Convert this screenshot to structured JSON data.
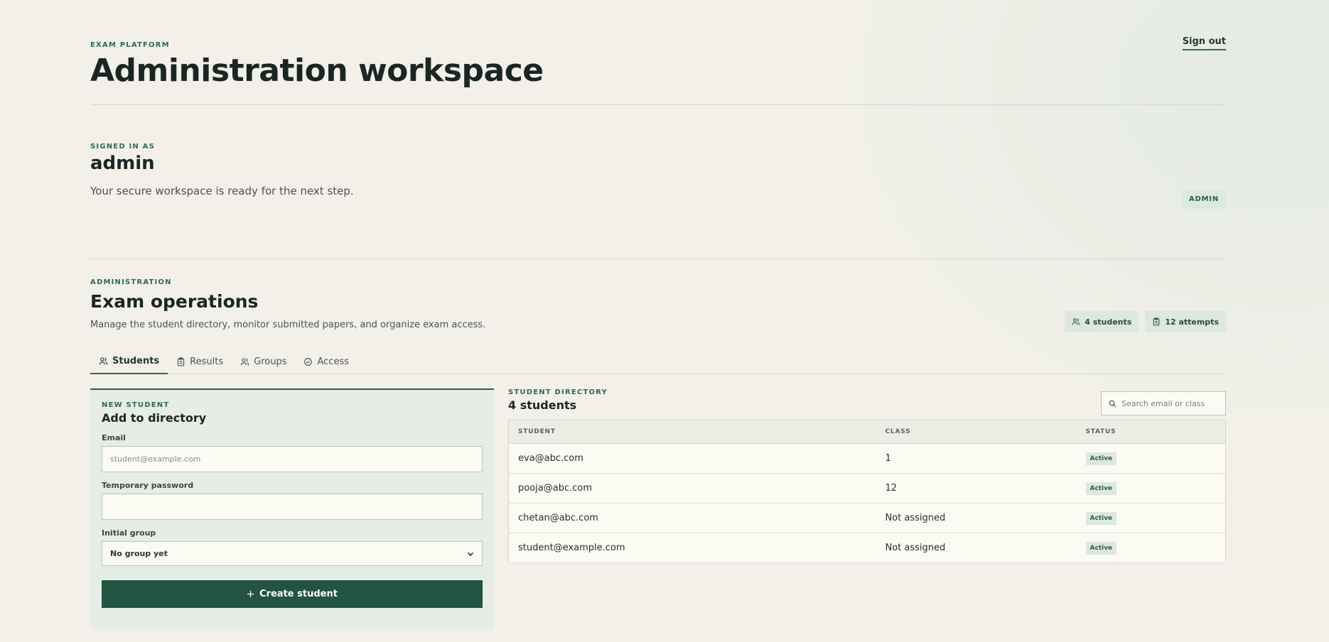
{
  "header": {
    "eyebrow": "EXAM PLATFORM",
    "title": "Administration workspace",
    "signout_label": "Sign out"
  },
  "session": {
    "eyebrow": "SIGNED IN AS",
    "username": "admin",
    "message": "Your secure workspace is ready for the next step.",
    "role_badge": "ADMIN"
  },
  "admin": {
    "eyebrow": "ADMINISTRATION",
    "title": "Exam operations",
    "description": "Manage the student directory, monitor submitted papers, and organize exam access.",
    "stats": {
      "students": "4 students",
      "attempts": "12 attempts"
    },
    "tabs": [
      {
        "label": "Students",
        "icon": "users-icon",
        "active": true
      },
      {
        "label": "Results",
        "icon": "clipboard-icon",
        "active": false
      },
      {
        "label": "Groups",
        "icon": "users-icon",
        "active": false
      },
      {
        "label": "Access",
        "icon": "check-circle-icon",
        "active": false
      }
    ]
  },
  "new_student": {
    "eyebrow": "NEW STUDENT",
    "title": "Add to directory",
    "email_label": "Email",
    "email_placeholder": "student@example.com",
    "password_label": "Temporary password",
    "password_value": "",
    "group_label": "Initial group",
    "group_selected": "No group yet",
    "create_label": "Create student"
  },
  "directory": {
    "eyebrow": "STUDENT DIRECTORY",
    "title": "4 students",
    "search_placeholder": "Search email or class",
    "columns": [
      "STUDENT",
      "CLASS",
      "STATUS"
    ],
    "rows": [
      {
        "student": "eva@abc.com",
        "class": "1",
        "status": "Active"
      },
      {
        "student": "pooja@abc.com",
        "class": "12",
        "status": "Active"
      },
      {
        "student": "chetan@abc.com",
        "class": "Not assigned",
        "status": "Active"
      },
      {
        "student": "student@example.com",
        "class": "Not assigned",
        "status": "Active"
      }
    ]
  },
  "colors": {
    "accent": "#2f6a50",
    "primary_button": "#225343",
    "background": "#f2f0e9",
    "badge_bg": "#dde8df"
  }
}
